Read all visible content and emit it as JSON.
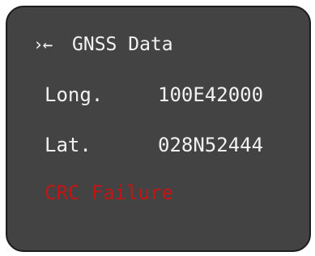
{
  "screen": {
    "header": {
      "icon": "back-arrow-icon",
      "icon_glyph": "›←",
      "title": "GNSS Data"
    },
    "rows": [
      {
        "label": "Long.",
        "value": "100E42000"
      },
      {
        "label": "Lat.",
        "value": "028N52444"
      }
    ],
    "status": {
      "text": "CRC Failure",
      "color": "#c41414"
    }
  },
  "colors": {
    "background": "#434343",
    "text": "#f2f2f2",
    "border": "#1c1c1c",
    "error": "#c41414"
  }
}
